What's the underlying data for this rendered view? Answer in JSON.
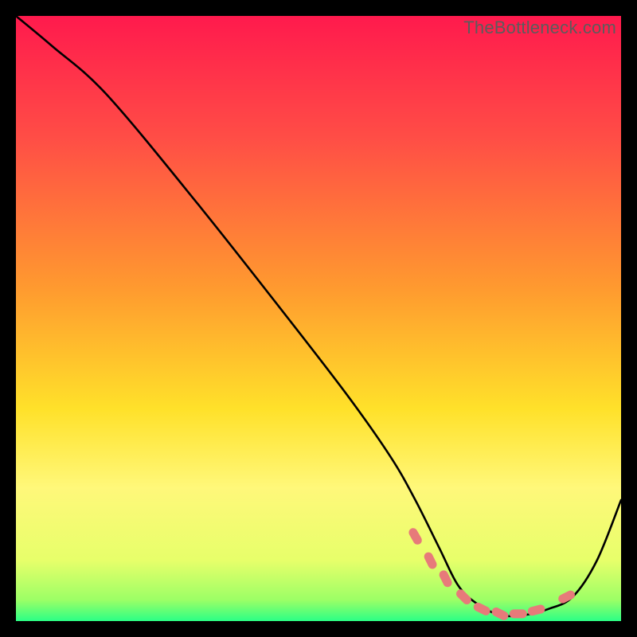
{
  "watermark": "TheBottleneck.com",
  "chart_data": {
    "type": "line",
    "title": "",
    "xlabel": "",
    "ylabel": "",
    "xlim": [
      0,
      100
    ],
    "ylim": [
      0,
      100
    ],
    "grid": false,
    "legend": false,
    "background_gradient": {
      "stops": [
        {
          "offset": 0.0,
          "color": "#ff1a4d"
        },
        {
          "offset": 0.2,
          "color": "#ff4d46"
        },
        {
          "offset": 0.45,
          "color": "#ff9a2f"
        },
        {
          "offset": 0.65,
          "color": "#ffe12a"
        },
        {
          "offset": 0.78,
          "color": "#fff87a"
        },
        {
          "offset": 0.9,
          "color": "#e7ff6a"
        },
        {
          "offset": 0.965,
          "color": "#9cff66"
        },
        {
          "offset": 1.0,
          "color": "#2bff86"
        }
      ]
    },
    "series": [
      {
        "name": "bottleneck-curve",
        "x": [
          0,
          6,
          15,
          30,
          45,
          55,
          62,
          66,
          70,
          73,
          76,
          80,
          84,
          88,
          92,
          96,
          100
        ],
        "y": [
          100,
          95,
          87,
          69,
          50,
          37,
          27,
          20,
          12,
          6,
          3,
          1,
          1,
          2,
          4,
          10,
          20
        ]
      }
    ],
    "markers": {
      "name": "highlight-dots",
      "color": "#e77a7a",
      "x": [
        66,
        68.5,
        71,
        74,
        77,
        80,
        83,
        86,
        91
      ],
      "y": [
        14,
        10,
        7,
        4,
        2,
        1.2,
        1.2,
        1.8,
        4
      ]
    }
  }
}
